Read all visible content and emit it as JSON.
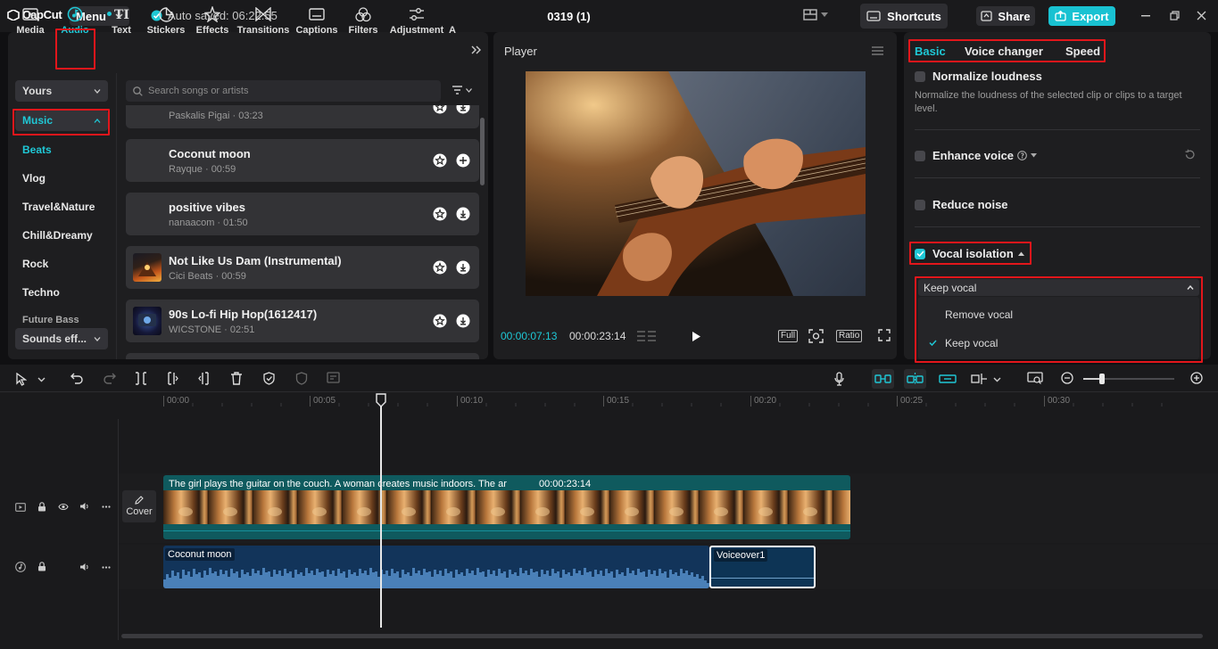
{
  "app": {
    "logo": "CapCut",
    "menu_label": "Menu",
    "autosave": "Auto saved: 06:22:55",
    "project_title": "0319 (1)",
    "shortcuts_label": "Shortcuts",
    "share_label": "Share",
    "export_label": "Export"
  },
  "tools": [
    {
      "label": "Media",
      "icon": "media-icon"
    },
    {
      "label": "Audio",
      "icon": "audio-icon",
      "active": true
    },
    {
      "label": "Text",
      "icon": "text-icon"
    },
    {
      "label": "Stickers",
      "icon": "sticker-icon"
    },
    {
      "label": "Effects",
      "icon": "effects-icon"
    },
    {
      "label": "Transitions",
      "icon": "transitions-icon"
    },
    {
      "label": "Captions",
      "icon": "captions-icon"
    },
    {
      "label": "Filters",
      "icon": "filters-icon"
    },
    {
      "label": "Adjustment",
      "icon": "adjustment-icon"
    },
    {
      "label": "A",
      "icon": ""
    }
  ],
  "sidebar": {
    "yours": "Yours",
    "music": "Music",
    "categories": [
      "Beats",
      "Vlog",
      "Travel&Nature",
      "Chill&Dreamy",
      "Rock",
      "Techno",
      "Future Bass"
    ],
    "sounds": "Sounds eff..."
  },
  "search": {
    "placeholder": "Search songs or artists"
  },
  "songs": [
    {
      "title": "",
      "meta": "Paskalis Pigai · 03:23"
    },
    {
      "title": "Coconut moon",
      "meta": "Rayque · 00:59"
    },
    {
      "title": "positive vibes",
      "meta": "nanaacom · 01:50"
    },
    {
      "title": "Not Like Us Dam (Instrumental)",
      "meta": "Cici Beats · 00:59"
    },
    {
      "title": "90s Lo-fi Hip Hop(1612417)",
      "meta": "WICSTONE · 02:51"
    }
  ],
  "player": {
    "title": "Player",
    "current_time": "00:00:07:13",
    "total_time": "00:00:23:14",
    "full_label": "Full",
    "ratio_label": "Ratio"
  },
  "right": {
    "tabs": [
      "Basic",
      "Voice changer",
      "Speed"
    ],
    "normalize_label": "Normalize loudness",
    "normalize_desc": "Normalize the loudness of the selected clip or clips to a target level.",
    "enhance_label": "Enhance voice",
    "reduce_label": "Reduce noise",
    "vocal_label": "Vocal isolation",
    "dropdown_value": "Keep vocal",
    "options": [
      "Remove vocal",
      "Keep vocal"
    ],
    "selected_option": "Keep vocal"
  },
  "timeline": {
    "ruler": [
      "00:00",
      "00:05",
      "00:10",
      "00:15",
      "00:20",
      "00:25",
      "00:30"
    ],
    "cover_label": "Cover",
    "video_clip_label": "The girl plays the guitar on the couch. A woman creates music indoors. The ar",
    "video_clip_duration": "00:00:23:14",
    "audio_clip_label": "Coconut moon",
    "voice_clip_label": "Voiceover1"
  },
  "colors": {
    "accent": "#1fc8d6",
    "highlight": "#e2161b",
    "video_clip": "#0f5a5e",
    "audio_clip": "#12345a"
  }
}
